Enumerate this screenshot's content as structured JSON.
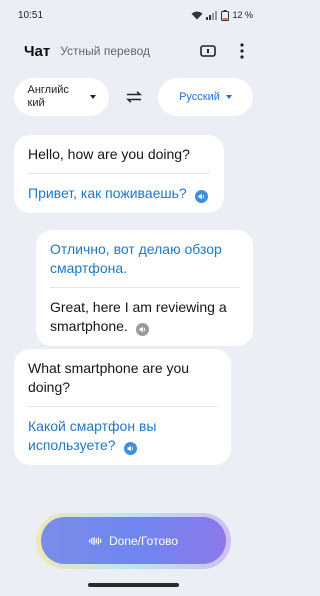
{
  "status": {
    "time": "10:51",
    "battery": "12 %"
  },
  "header": {
    "active_tab": "Чат",
    "inactive_tab": "Устный перевод",
    "icons": [
      "screen-icon",
      "more-vert-icon"
    ]
  },
  "languages": {
    "source": "Английс кий",
    "target": "Русский",
    "swap_icon": "swap-icon"
  },
  "messages": [
    {
      "original": "Hello, how are you doing?",
      "translation": "Привет, как поживаешь?"
    },
    {
      "translation": "Отлично, вот делаю обзор смартфона.",
      "original": "Great, here I am reviewing a smartphone."
    },
    {
      "original": "What smartphone are you doing?",
      "translation": "Какой смартфон вы используете?"
    }
  ],
  "done_button": {
    "label": "Done/Готово"
  },
  "colors": {
    "accent": "#1f77c4",
    "speaker_blue": "#3d8ee0",
    "speaker_gray": "#9a9a9f",
    "button_start": "#7a8de8",
    "button_end": "#8a79ea",
    "background": "#eceef6"
  }
}
